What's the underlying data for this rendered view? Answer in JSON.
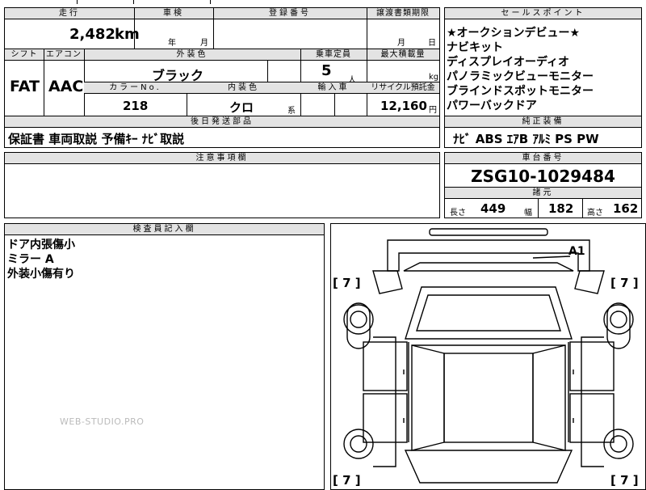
{
  "headers": {
    "mileage": "走行",
    "inspection": "車検",
    "registration": "登録番号",
    "transfer_deadline": "譲渡書類期限",
    "sales_points": "セールスポイント",
    "shift": "シフト",
    "aircon": "エアコン",
    "exterior_color": "外装色",
    "capacity": "乗車定員",
    "max_load": "最大積載量",
    "color_no": "カラーNo.",
    "interior_color": "内装色",
    "import": "輸入車",
    "recycle": "リサイクル預託金",
    "later_parts": "後日発送部品",
    "genuine_equipment": "純正装備",
    "notes": "注意事項欄",
    "chassis_no": "車台番号",
    "specs": "諸元",
    "inspector_notes": "検査員記入欄"
  },
  "vehicle": {
    "mileage": "2,482",
    "mileage_unit": "km",
    "inspection_year_label": "年",
    "inspection_month_label": "月",
    "transfer_month_label": "月",
    "transfer_day_label": "日",
    "shift": "FAT",
    "aircon": "AAC",
    "exterior_color": "ブラック",
    "capacity": "5",
    "capacity_unit": "人",
    "max_load_unit": "kg",
    "color_no": "218",
    "interior_color": "クロ",
    "interior_suffix": "系",
    "recycle_fee": "12,160",
    "recycle_unit": "円"
  },
  "sales_points": [
    "★オークションデビュー★",
    "ナビキット",
    "ディスプレイオーディオ",
    "パノラミックビューモニター",
    "ブラインドスポットモニター",
    "パワーバックドア"
  ],
  "later_parts_text": "保証書 車両取説 予備ｷｰ ﾅﾋﾞ取説",
  "genuine_equipment_text": "ﾅﾋﾞ ABS ｴｱB ｱﾙﾐ PS PW",
  "chassis_number": "ZSG10-1029484",
  "specs": {
    "length_label": "長さ",
    "length": "449",
    "width_label": "幅",
    "width": "182",
    "height_label": "高さ",
    "height": "162"
  },
  "inspector_notes": [
    "ドア内張傷小",
    "ミラー A",
    "外装小傷有り"
  ],
  "diagram": {
    "mark_a1": "A1",
    "tire_labels": [
      "[ 7 ]",
      "[ 7 ]",
      "[ 7 ]",
      "[ 7 ]"
    ]
  },
  "watermark": "WEB-STUDIO.PRO"
}
